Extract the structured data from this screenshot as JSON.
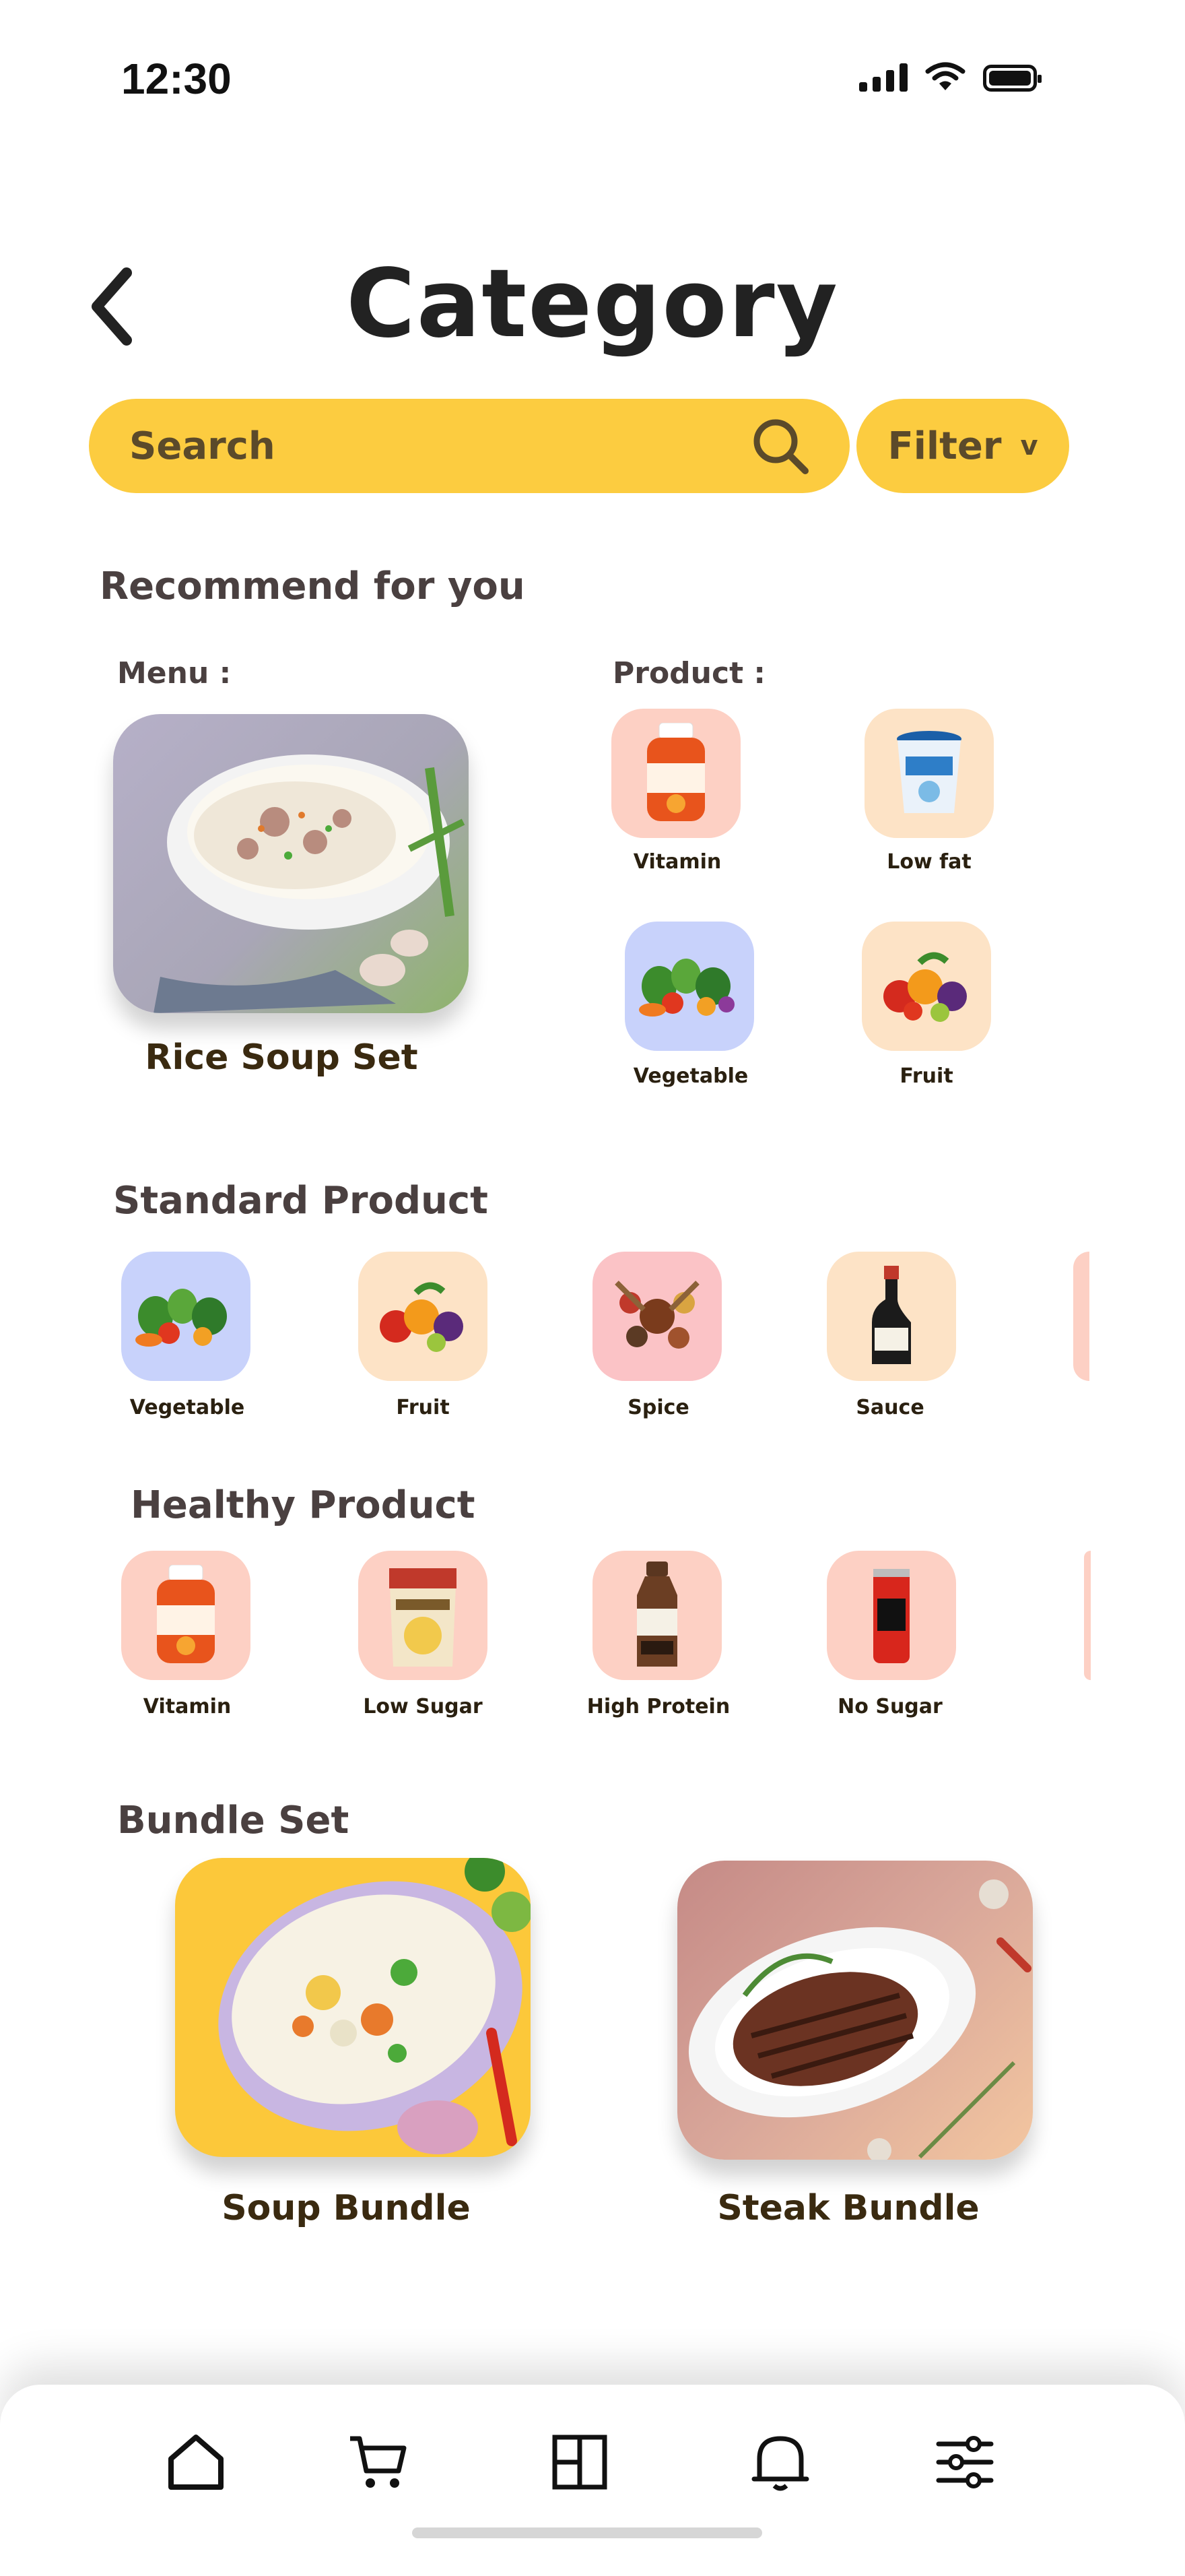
{
  "status": {
    "time": "12:30"
  },
  "header": {
    "title": "Category"
  },
  "search": {
    "placeholder": "Search",
    "filter_label": "Filter",
    "filter_chevron": "v"
  },
  "recommend": {
    "title": "Recommend for you",
    "menu_label": "Menu :",
    "menu_item": "Rice Soup Set",
    "product_label": "Product :",
    "products": [
      {
        "label": "Vitamin"
      },
      {
        "label": "Low fat"
      },
      {
        "label": "Vegetable"
      },
      {
        "label": "Fruit"
      }
    ]
  },
  "standard": {
    "title": "Standard Product",
    "items": [
      {
        "label": "Vegetable"
      },
      {
        "label": "Fruit"
      },
      {
        "label": "Spice"
      },
      {
        "label": "Sauce"
      }
    ]
  },
  "healthy": {
    "title": "Healthy Product",
    "items": [
      {
        "label": "Vitamin"
      },
      {
        "label": "Low Sugar"
      },
      {
        "label": "High Protein"
      },
      {
        "label": "No Sugar"
      }
    ]
  },
  "bundle": {
    "title": "Bundle Set",
    "items": [
      {
        "label": "Soup Bundle"
      },
      {
        "label": "Steak Bundle"
      }
    ]
  },
  "nav": [
    "home-icon",
    "cart-icon",
    "grid-icon",
    "bell-icon",
    "settings-sliders-icon"
  ],
  "colors": {
    "accent": "#fccc40",
    "pink": "#fdd0c4",
    "peach": "#fde3c6",
    "blue": "#c8d2fb"
  }
}
